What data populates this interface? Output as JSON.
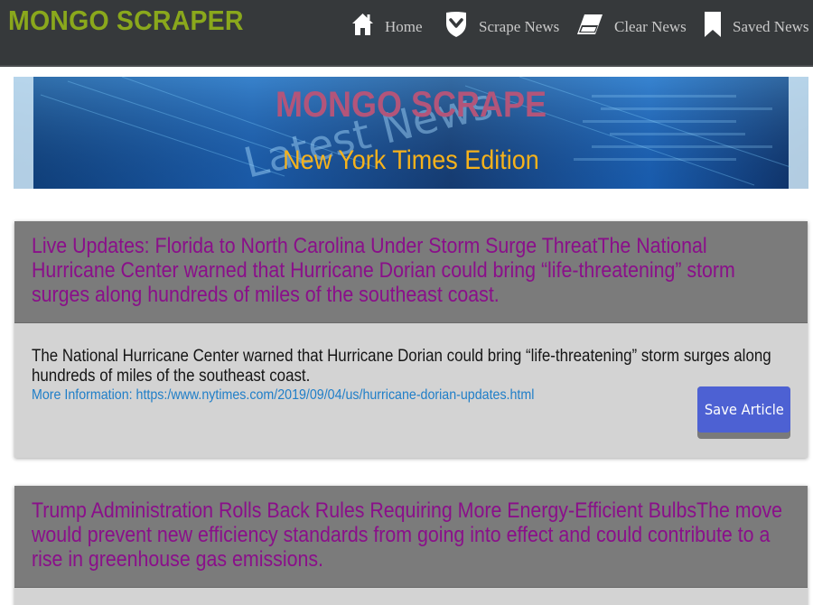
{
  "navbar": {
    "brand": "MONGO SCRAPER",
    "items": [
      {
        "label": "Home",
        "icon": "home-icon"
      },
      {
        "label": "Scrape News",
        "icon": "shield-chevron-icon"
      },
      {
        "label": "Clear News",
        "icon": "eraser-icon"
      },
      {
        "label": "Saved News",
        "icon": "bookmark-icon"
      }
    ]
  },
  "banner": {
    "title": "MONGO SCRAPE",
    "subtitle": "New York Times Edition",
    "background_text": "Latest News",
    "colors": {
      "title": "#b2557a",
      "subtitle": "#f6b21b",
      "background": "#12305a"
    }
  },
  "articles": [
    {
      "title": "Live Updates: Florida to North Carolina Under Storm Surge ThreatThe National Hurricane Center warned that Hurricane Dorian could bring “life-threatening” storm surges along hundreds of miles of the southeast coast.",
      "summary": "The National Hurricane Center warned that Hurricane Dorian could bring “life-threatening” storm surges along hundreds of miles of the southeast coast.",
      "link_text": "More Information: https:/www.nytimes.com/2019/09/04/us/hurricane-dorian-updates.html",
      "save_label": "Save Article"
    },
    {
      "title": "Trump Administration Rolls Back Rules Requiring More Energy-Efficient BulbsThe move would prevent new efficiency standards from going into effect and could contribute to a rise in greenhouse gas emissions."
    }
  ],
  "colors": {
    "navbar_bg": "#36393b",
    "brand": "#8aa81c",
    "card_head_bg": "#7b7b7b",
    "card_title": "#8a0f8a",
    "card_body_bg": "#d3d3d3",
    "link": "#1f7ec8",
    "button": "#4d61d3"
  }
}
